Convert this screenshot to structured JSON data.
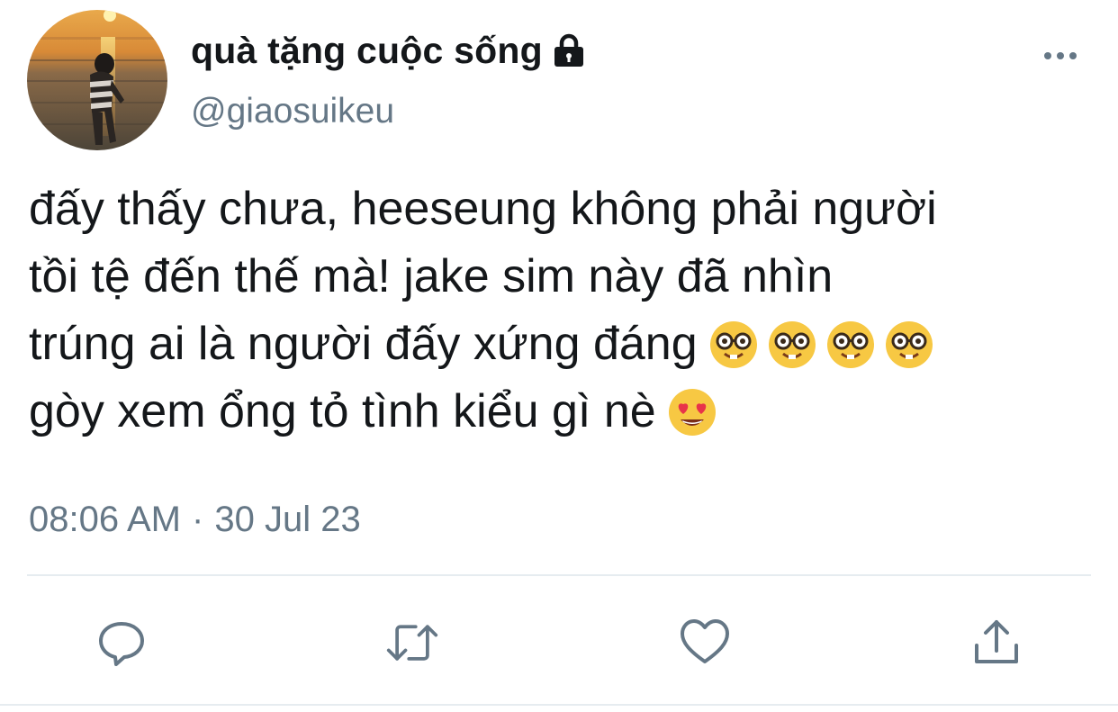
{
  "user": {
    "display_name": "quà tặng cuộc sống",
    "handle": "@giaosuikeu",
    "avatar_icon": "avatar-sunset-beach",
    "protected_icon": "lock-icon"
  },
  "tweet": {
    "lines": [
      "đấy thấy chưa, heeseung không phải người",
      "tồi tệ đến thế mà! jake sim này đã nhìn",
      "trúng ai là người đấy xứng đáng",
      "gòy xem ổng tỏ tình kiểu gì nè"
    ],
    "emojis": {
      "line3": [
        "🤓",
        "🤓",
        "🤓",
        "🤓"
      ],
      "line4": [
        "😍"
      ]
    },
    "time": "08:06 AM",
    "separator": "·",
    "date": "30 Jul 23"
  },
  "actions": {
    "reply_icon": "reply-icon",
    "retweet_icon": "retweet-icon",
    "like_icon": "heart-icon",
    "share_icon": "share-icon"
  },
  "colors": {
    "text_primary": "#14171a",
    "text_secondary": "#657786",
    "icon": "#657786",
    "divider": "#e6ecf0"
  }
}
